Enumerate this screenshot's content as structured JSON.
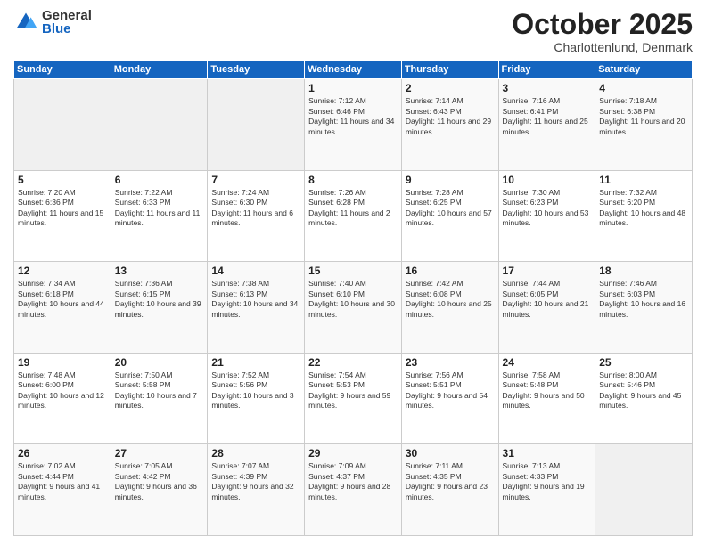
{
  "logo": {
    "general": "General",
    "blue": "Blue"
  },
  "title": "October 2025",
  "subtitle": "Charlottenlund, Denmark",
  "days_header": [
    "Sunday",
    "Monday",
    "Tuesday",
    "Wednesday",
    "Thursday",
    "Friday",
    "Saturday"
  ],
  "weeks": [
    [
      {
        "day": "",
        "sunrise": "",
        "sunset": "",
        "daylight": ""
      },
      {
        "day": "",
        "sunrise": "",
        "sunset": "",
        "daylight": ""
      },
      {
        "day": "",
        "sunrise": "",
        "sunset": "",
        "daylight": ""
      },
      {
        "day": "1",
        "sunrise": "Sunrise: 7:12 AM",
        "sunset": "Sunset: 6:46 PM",
        "daylight": "Daylight: 11 hours and 34 minutes."
      },
      {
        "day": "2",
        "sunrise": "Sunrise: 7:14 AM",
        "sunset": "Sunset: 6:43 PM",
        "daylight": "Daylight: 11 hours and 29 minutes."
      },
      {
        "day": "3",
        "sunrise": "Sunrise: 7:16 AM",
        "sunset": "Sunset: 6:41 PM",
        "daylight": "Daylight: 11 hours and 25 minutes."
      },
      {
        "day": "4",
        "sunrise": "Sunrise: 7:18 AM",
        "sunset": "Sunset: 6:38 PM",
        "daylight": "Daylight: 11 hours and 20 minutes."
      }
    ],
    [
      {
        "day": "5",
        "sunrise": "Sunrise: 7:20 AM",
        "sunset": "Sunset: 6:36 PM",
        "daylight": "Daylight: 11 hours and 15 minutes."
      },
      {
        "day": "6",
        "sunrise": "Sunrise: 7:22 AM",
        "sunset": "Sunset: 6:33 PM",
        "daylight": "Daylight: 11 hours and 11 minutes."
      },
      {
        "day": "7",
        "sunrise": "Sunrise: 7:24 AM",
        "sunset": "Sunset: 6:30 PM",
        "daylight": "Daylight: 11 hours and 6 minutes."
      },
      {
        "day": "8",
        "sunrise": "Sunrise: 7:26 AM",
        "sunset": "Sunset: 6:28 PM",
        "daylight": "Daylight: 11 hours and 2 minutes."
      },
      {
        "day": "9",
        "sunrise": "Sunrise: 7:28 AM",
        "sunset": "Sunset: 6:25 PM",
        "daylight": "Daylight: 10 hours and 57 minutes."
      },
      {
        "day": "10",
        "sunrise": "Sunrise: 7:30 AM",
        "sunset": "Sunset: 6:23 PM",
        "daylight": "Daylight: 10 hours and 53 minutes."
      },
      {
        "day": "11",
        "sunrise": "Sunrise: 7:32 AM",
        "sunset": "Sunset: 6:20 PM",
        "daylight": "Daylight: 10 hours and 48 minutes."
      }
    ],
    [
      {
        "day": "12",
        "sunrise": "Sunrise: 7:34 AM",
        "sunset": "Sunset: 6:18 PM",
        "daylight": "Daylight: 10 hours and 44 minutes."
      },
      {
        "day": "13",
        "sunrise": "Sunrise: 7:36 AM",
        "sunset": "Sunset: 6:15 PM",
        "daylight": "Daylight: 10 hours and 39 minutes."
      },
      {
        "day": "14",
        "sunrise": "Sunrise: 7:38 AM",
        "sunset": "Sunset: 6:13 PM",
        "daylight": "Daylight: 10 hours and 34 minutes."
      },
      {
        "day": "15",
        "sunrise": "Sunrise: 7:40 AM",
        "sunset": "Sunset: 6:10 PM",
        "daylight": "Daylight: 10 hours and 30 minutes."
      },
      {
        "day": "16",
        "sunrise": "Sunrise: 7:42 AM",
        "sunset": "Sunset: 6:08 PM",
        "daylight": "Daylight: 10 hours and 25 minutes."
      },
      {
        "day": "17",
        "sunrise": "Sunrise: 7:44 AM",
        "sunset": "Sunset: 6:05 PM",
        "daylight": "Daylight: 10 hours and 21 minutes."
      },
      {
        "day": "18",
        "sunrise": "Sunrise: 7:46 AM",
        "sunset": "Sunset: 6:03 PM",
        "daylight": "Daylight: 10 hours and 16 minutes."
      }
    ],
    [
      {
        "day": "19",
        "sunrise": "Sunrise: 7:48 AM",
        "sunset": "Sunset: 6:00 PM",
        "daylight": "Daylight: 10 hours and 12 minutes."
      },
      {
        "day": "20",
        "sunrise": "Sunrise: 7:50 AM",
        "sunset": "Sunset: 5:58 PM",
        "daylight": "Daylight: 10 hours and 7 minutes."
      },
      {
        "day": "21",
        "sunrise": "Sunrise: 7:52 AM",
        "sunset": "Sunset: 5:56 PM",
        "daylight": "Daylight: 10 hours and 3 minutes."
      },
      {
        "day": "22",
        "sunrise": "Sunrise: 7:54 AM",
        "sunset": "Sunset: 5:53 PM",
        "daylight": "Daylight: 9 hours and 59 minutes."
      },
      {
        "day": "23",
        "sunrise": "Sunrise: 7:56 AM",
        "sunset": "Sunset: 5:51 PM",
        "daylight": "Daylight: 9 hours and 54 minutes."
      },
      {
        "day": "24",
        "sunrise": "Sunrise: 7:58 AM",
        "sunset": "Sunset: 5:48 PM",
        "daylight": "Daylight: 9 hours and 50 minutes."
      },
      {
        "day": "25",
        "sunrise": "Sunrise: 8:00 AM",
        "sunset": "Sunset: 5:46 PM",
        "daylight": "Daylight: 9 hours and 45 minutes."
      }
    ],
    [
      {
        "day": "26",
        "sunrise": "Sunrise: 7:02 AM",
        "sunset": "Sunset: 4:44 PM",
        "daylight": "Daylight: 9 hours and 41 minutes."
      },
      {
        "day": "27",
        "sunrise": "Sunrise: 7:05 AM",
        "sunset": "Sunset: 4:42 PM",
        "daylight": "Daylight: 9 hours and 36 minutes."
      },
      {
        "day": "28",
        "sunrise": "Sunrise: 7:07 AM",
        "sunset": "Sunset: 4:39 PM",
        "daylight": "Daylight: 9 hours and 32 minutes."
      },
      {
        "day": "29",
        "sunrise": "Sunrise: 7:09 AM",
        "sunset": "Sunset: 4:37 PM",
        "daylight": "Daylight: 9 hours and 28 minutes."
      },
      {
        "day": "30",
        "sunrise": "Sunrise: 7:11 AM",
        "sunset": "Sunset: 4:35 PM",
        "daylight": "Daylight: 9 hours and 23 minutes."
      },
      {
        "day": "31",
        "sunrise": "Sunrise: 7:13 AM",
        "sunset": "Sunset: 4:33 PM",
        "daylight": "Daylight: 9 hours and 19 minutes."
      },
      {
        "day": "",
        "sunrise": "",
        "sunset": "",
        "daylight": ""
      }
    ]
  ]
}
